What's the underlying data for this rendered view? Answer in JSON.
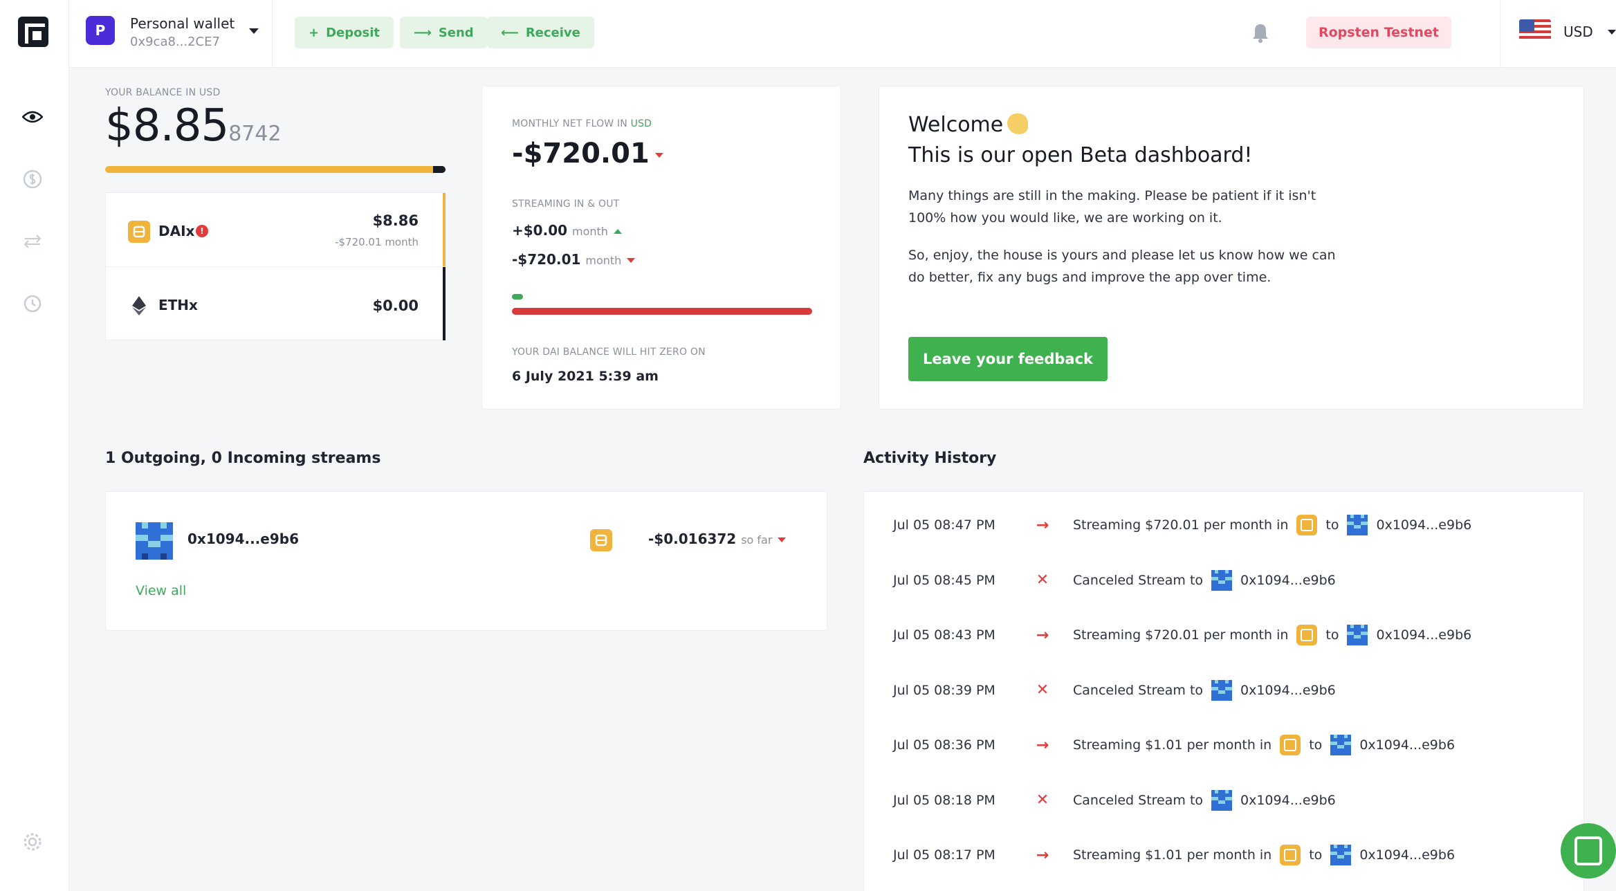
{
  "header": {
    "wallet_avatar_letter": "P",
    "wallet_name": "Personal wallet",
    "wallet_address": "0x9ca8...2CE7",
    "deposit_label": "Deposit",
    "send_label": "Send",
    "receive_label": "Receive",
    "network": "Ropsten Testnet",
    "currency": "USD"
  },
  "balance": {
    "label": "YOUR BALANCE IN USD",
    "main": "$8.85",
    "fraction": "8742"
  },
  "tokens": [
    {
      "name": "DAIx",
      "value": "$8.86",
      "flow": "-$720.01",
      "flow_period": "month",
      "alert": "!"
    },
    {
      "name": "ETHx",
      "value": "$0.00"
    }
  ],
  "flow": {
    "label_prefix": "MONTHLY NET FLOW IN",
    "label_currency": "USD",
    "net": "-$720.01",
    "streaming_label": "STREAMING IN & OUT",
    "in_value": "+$0.00",
    "out_value": "-$720.01",
    "period": "month",
    "zero_label": "YOUR DAI BALANCE WILL HIT ZERO ON",
    "zero_date": "6 July 2021 5:39 am",
    "in_fraction": 0.0,
    "out_fraction": 1.0
  },
  "welcome": {
    "greeting": "Welcome",
    "headline": "This is our open Beta dashboard!",
    "p1": "Many things are still in the making. Please be patient if it isn't 100% how you would like, we are working on it.",
    "p2": "So, enjoy, the house is yours and please let us know how we can do better, fix any bugs and improve the app over time.",
    "button": "Leave your feedback"
  },
  "streams": {
    "title": "1 Outgoing, 0 Incoming streams",
    "rows": [
      {
        "address": "0x1094...e9b6",
        "amount": "-$0.016372",
        "suffix": "so far"
      }
    ],
    "view_all": "View all"
  },
  "activity": {
    "title": "Activity History",
    "items": [
      {
        "time": "Jul 05 08:47 PM",
        "type": "stream",
        "text_before": "Streaming $720.01 per month in",
        "to": "to",
        "address": "0x1094...e9b6"
      },
      {
        "time": "Jul 05 08:45 PM",
        "type": "cancel",
        "text_before": "Canceled Stream to",
        "address": "0x1094...e9b6"
      },
      {
        "time": "Jul 05 08:43 PM",
        "type": "stream",
        "text_before": "Streaming $720.01 per month in",
        "to": "to",
        "address": "0x1094...e9b6"
      },
      {
        "time": "Jul 05 08:39 PM",
        "type": "cancel",
        "text_before": "Canceled Stream to",
        "address": "0x1094...e9b6"
      },
      {
        "time": "Jul 05 08:36 PM",
        "type": "stream",
        "text_before": "Streaming $1.01 per month in",
        "to": "to",
        "address": "0x1094...e9b6"
      },
      {
        "time": "Jul 05 08:18 PM",
        "type": "cancel",
        "text_before": "Canceled Stream to",
        "address": "0x1094...e9b6"
      },
      {
        "time": "Jul 05 08:17 PM",
        "type": "stream",
        "text_before": "Streaming $1.01 per month in",
        "to": "to",
        "address": "0x1094...e9b6"
      }
    ]
  },
  "colors": {
    "accent_green": "#3fb24f",
    "negative_red": "#e23b3b",
    "dai_orange": "#f0b43c",
    "brand_purple": "#4c2bd9"
  },
  "icons": {
    "arrow": "→",
    "cross": "✕"
  }
}
